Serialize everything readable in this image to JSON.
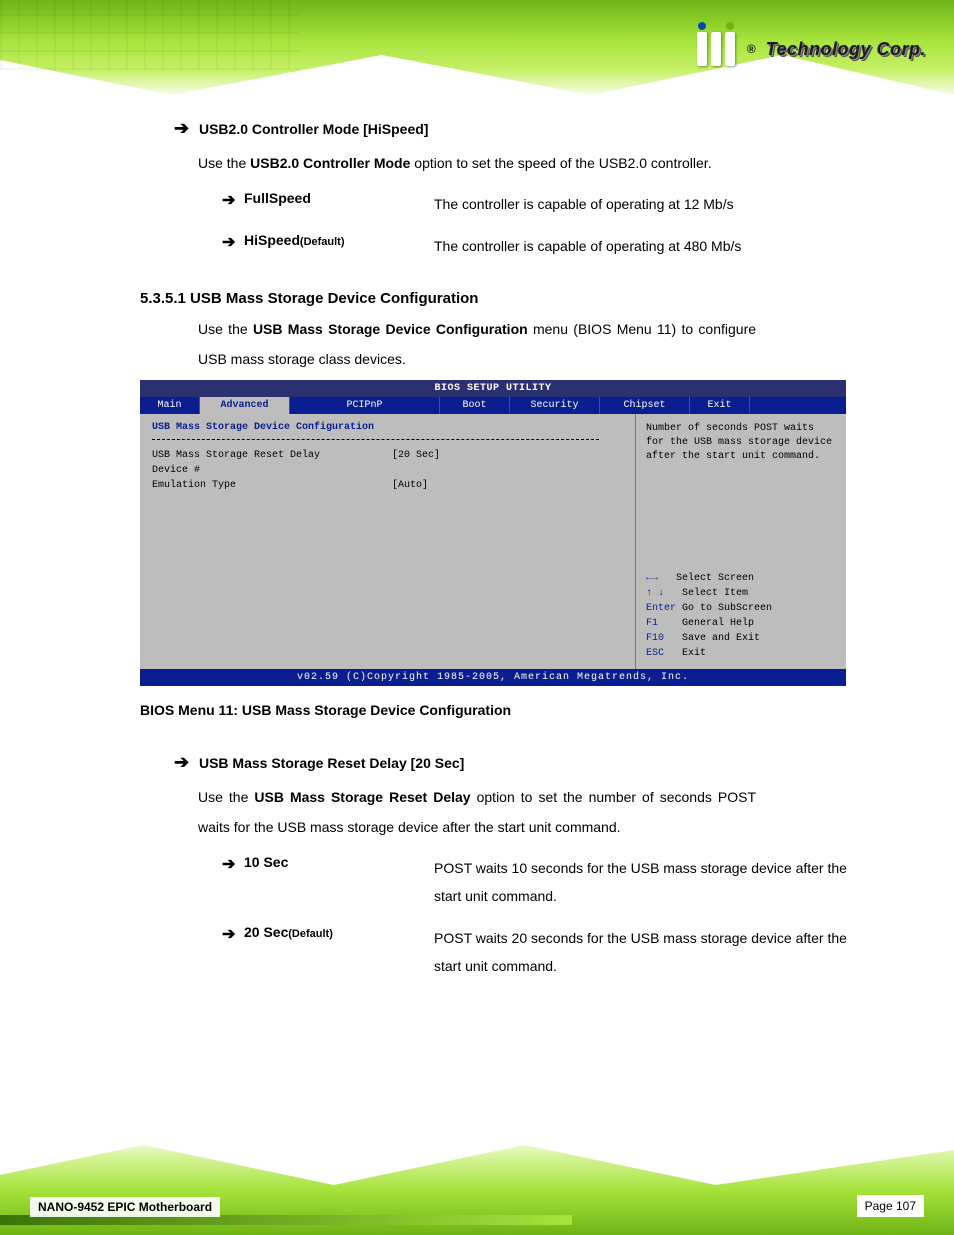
{
  "header": {
    "brand_reg": "®",
    "brand_text": "Technology Corp."
  },
  "footer": {
    "doc_title": "NANO-9452 EPIC Motherboard",
    "page_label": "Page 107"
  },
  "sec1": {
    "arrow": "➔",
    "title": "USB2.0 Controller Mode [HiSpeed]",
    "intro_1": "Use the ",
    "intro_bold": "USB2.0 Controller Mode",
    "intro_2": " option to set the speed of the USB2.0 controller.",
    "opts": [
      {
        "name": "FullSpeed",
        "def": "",
        "desc": "The controller is capable of operating at 12 Mb/s"
      },
      {
        "name": "HiSpeed",
        "def": "(Default)",
        "desc": "The controller is capable of operating at 480 Mb/s"
      }
    ]
  },
  "sec2": {
    "heading": "5.3.5.1  USB Mass Storage Device Configuration",
    "intro_1": "Use the ",
    "intro_bold": "USB Mass Storage Device Configuration",
    "intro_2": " menu (BIOS Menu 11) to configure USB mass storage class devices."
  },
  "bios": {
    "title": "BIOS SETUP UTILITY",
    "tabs": [
      "Main",
      "Advanced",
      "PCIPnP",
      "Boot",
      "Security",
      "Chipset",
      "Exit"
    ],
    "panel_heading": "USB Mass Storage Device Configuration",
    "rows": [
      {
        "k": "USB Mass Storage Reset Delay",
        "v": "[20 Sec]"
      },
      {
        "k": "Device #",
        "v": ""
      },
      {
        "k": "Emulation Type",
        "v": "[Auto]"
      }
    ],
    "hint": "Number of seconds POST waits for the USB mass storage device after the start unit command.",
    "keys": [
      {
        "k": "←→",
        "t": "Select Screen"
      },
      {
        "k": "↑ ↓",
        "t": "Select Item"
      },
      {
        "k": "Enter",
        "t": "Go to SubScreen"
      },
      {
        "k": "F1",
        "t": "General Help"
      },
      {
        "k": "F10",
        "t": "Save and Exit"
      },
      {
        "k": "ESC",
        "t": "Exit"
      }
    ],
    "footer": "v02.59 (C)Copyright 1985-2005, American Megatrends, Inc.",
    "caption": "BIOS Menu 11: USB Mass Storage Device Configuration"
  },
  "sec3": {
    "arrow": "➔",
    "title": "USB Mass Storage Reset Delay [20 Sec]",
    "intro_1": "Use the ",
    "intro_bold": "USB Mass Storage Reset Delay",
    "intro_2": " option to set the number of seconds POST waits for the USB mass storage device after the start unit command.",
    "opts": [
      {
        "name": "10 Sec",
        "def": "",
        "desc": "POST waits 10 seconds for the USB mass storage device after the start unit command."
      },
      {
        "name": "20 Sec",
        "def": "(Default)",
        "desc": "POST waits 20 seconds for the USB mass storage device after the start unit command."
      }
    ]
  }
}
